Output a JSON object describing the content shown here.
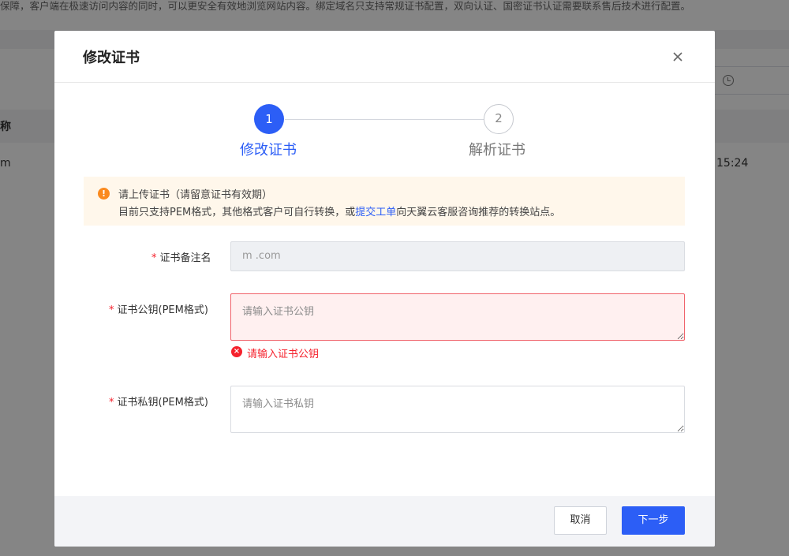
{
  "background": {
    "notice_text": "保障，客户端在极速访问内容的同时，可以更安全有效地浏览网站内容。绑定域名只支持常规证书配置，双向认证、国密证书认证需要联系售后技术进行配置。",
    "table_header_fragment": "称",
    "row_cell_left": "m",
    "row_cell_right": "15:24"
  },
  "dialog": {
    "title": "修改证书",
    "steps": [
      {
        "number": "1",
        "label": "修改证书",
        "state": "active"
      },
      {
        "number": "2",
        "label": "解析证书",
        "state": "pending"
      }
    ],
    "alert": {
      "title": "请上传证书（请留意证书有效期）",
      "text_before_link": "目前只支持PEM格式，其他格式客户可自行转换，或",
      "link_text": "提交工单",
      "text_after_link": "向天翼云客服咨询推荐的转换站点。"
    },
    "form": {
      "cert_name": {
        "label": "证书备注名",
        "value": "m        .com"
      },
      "public_key": {
        "label": "证书公钥(PEM格式)",
        "placeholder": "请输入证书公钥",
        "error": "请输入证书公钥"
      },
      "private_key": {
        "label": "证书私钥(PEM格式)",
        "placeholder": "请输入证书私钥"
      }
    },
    "footer": {
      "cancel_label": "取消",
      "next_label": "下一步"
    }
  },
  "colors": {
    "primary": "#2c5ef6",
    "error": "#f5222d",
    "warning": "#fa8a1f"
  }
}
